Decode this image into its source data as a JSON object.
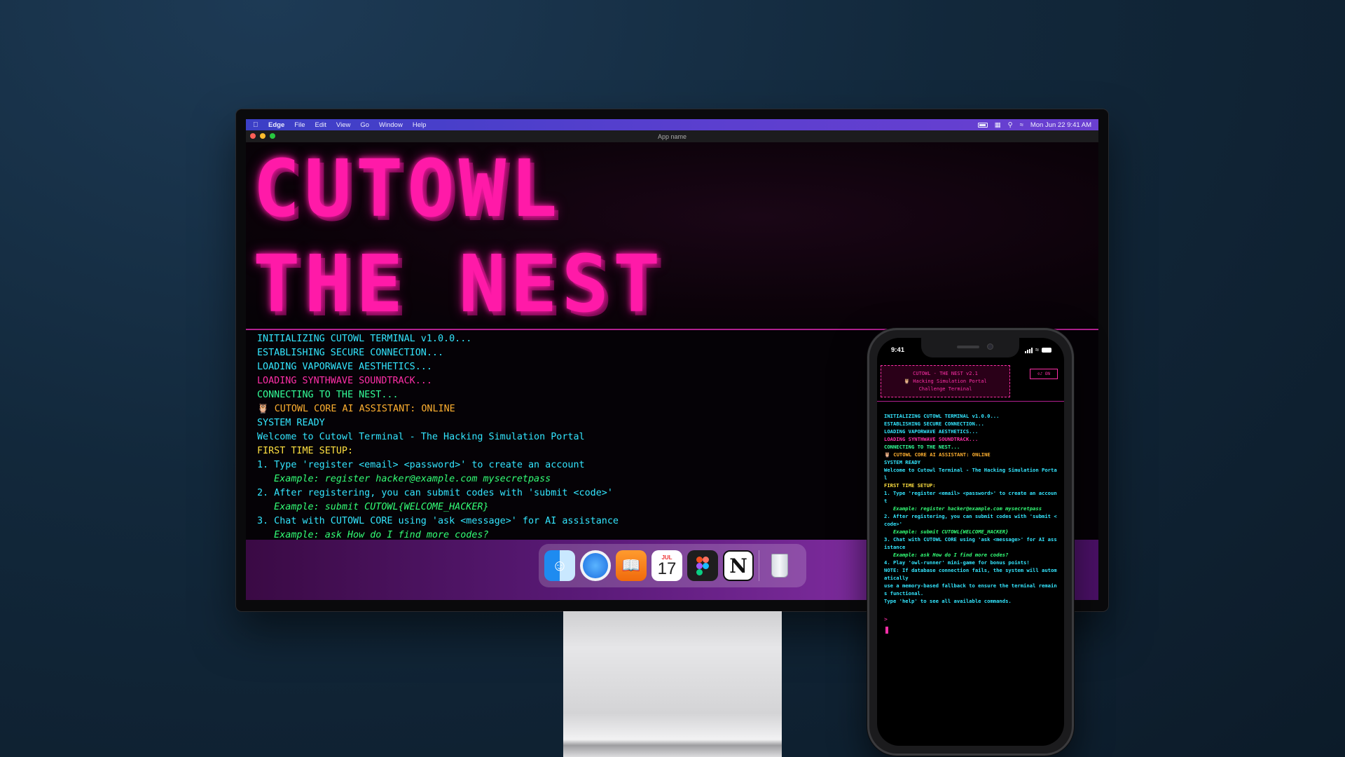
{
  "menubar": {
    "items": [
      "Edge",
      "File",
      "Edit",
      "View",
      "Go",
      "Window",
      "Help"
    ],
    "datetime": "Mon Jun 22  9:41 AM"
  },
  "window": {
    "title": "App name"
  },
  "banner": {
    "line1": "CUTOWL",
    "line2": "THE NEST"
  },
  "terminal": {
    "lines": [
      "INITIALIZING CUTOWL TERMINAL v1.0.0...",
      "ESTABLISHING SECURE CONNECTION...",
      "LOADING VAPORWAVE AESTHETICS...",
      "LOADING SYNTHWAVE SOUNDTRACK...",
      "CONNECTING TO THE NEST...",
      "🦉 CUTOWL CORE AI ASSISTANT: ONLINE",
      "SYSTEM READY",
      "Welcome to Cutowl Terminal - The Hacking Simulation Portal",
      "FIRST TIME SETUP:",
      "1. Type 'register <email> <password>' to create an account",
      "   Example: register hacker@example.com mysecretpass",
      "2. After registering, you can submit codes with 'submit <code>'",
      "   Example: submit CUTOWL{WELCOME_HACKER}",
      "3. Chat with CUTOWL CORE using 'ask <message>' for AI assistance",
      "   Example: ask How do I find more codes?"
    ]
  },
  "dock": {
    "apps": [
      "Finder",
      "Safari",
      "Books",
      "Calendar",
      "Figma",
      "Notion",
      "Trash"
    ],
    "calendar_month": "JUL",
    "calendar_day": "17",
    "notion_letter": "N"
  },
  "phone": {
    "time": "9:41",
    "header_line1": "CUTOWL - THE NEST v2.1",
    "header_line2": "🦉 Hacking Simulation Portal",
    "header_line3": "Challenge Terminal",
    "toggle_label": "⊙♪ ON",
    "prompt": ">",
    "lines": [
      "INITIALIZING CUTOWL TERMINAL v1.0.0...",
      "ESTABLISHING SECURE CONNECTION...",
      "LOADING VAPORWAVE AESTHETICS...",
      "LOADING SYNTHWAVE SOUNDTRACK...",
      "CONNECTING TO THE NEST...",
      "🦉 CUTOWL CORE AI ASSISTANT: ONLINE",
      "SYSTEM READY",
      "Welcome to Cutowl Terminal - The Hacking Simulation Portal",
      "FIRST TIME SETUP:",
      "1. Type 'register <email> <password>' to create an account",
      "   Example: register hacker@example.com mysecretpass",
      "2. After registering, you can submit codes with 'submit <code>'",
      "   Example: submit CUTOWL{WELCOME_HACKER}",
      "3. Chat with CUTOWL CORE using 'ask <message>' for AI assistance",
      "   Example: ask How do I find more codes?",
      "4. Play 'owl-runner' mini-game for bonus points!",
      "NOTE: If database connection fails, the system will automatically",
      "use a memory-based fallback to ensure the terminal remains functional.",
      "Type 'help' to see all available commands."
    ]
  },
  "colors": {
    "neon_pink": "#ff1aa8",
    "cyan": "#33e6ff",
    "green": "#33ff99",
    "yellow": "#ffe040",
    "orange": "#ffb030"
  }
}
